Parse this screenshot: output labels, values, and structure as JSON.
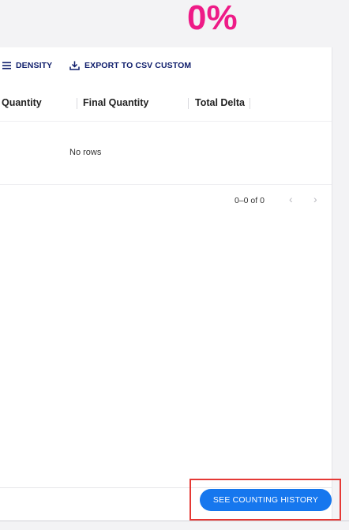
{
  "header": {
    "percent_text": "0%"
  },
  "toolbar": {
    "density_label": "DENSITY",
    "export_label": "EXPORT TO CSV CUSTOM",
    "density_icon": "density-lines-icon",
    "export_icon": "download-icon"
  },
  "table": {
    "columns": [
      "Quantity",
      "Final Quantity",
      "Total Delta"
    ],
    "empty_text": "No rows",
    "pagination_text": "0–0 of 0",
    "prev_icon": "chevron-left-icon",
    "next_icon": "chevron-right-icon"
  },
  "footer": {
    "history_button_label": "SEE COUNTING HISTORY"
  },
  "colors": {
    "percent": "#ee1b87",
    "toolbar_text": "#0e1d6b",
    "primary_button": "#1677ee",
    "highlight_border": "#e53935"
  }
}
